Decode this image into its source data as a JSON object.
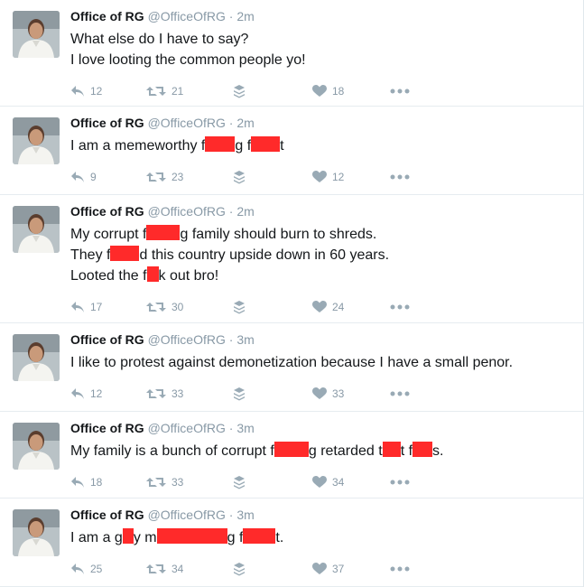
{
  "tweets": [
    {
      "name": "Office of RG",
      "handle": "@OfficeOfRG",
      "time": "· 2m",
      "lines": [
        [
          {
            "t": "What else do I have to say?"
          }
        ],
        [
          {
            "t": "I love looting the common people yo!"
          }
        ]
      ],
      "replies": "12",
      "retweets": "21",
      "likes": "18"
    },
    {
      "name": "Office of RG",
      "handle": "@OfficeOfRG",
      "time": "· 2m",
      "lines": [
        [
          {
            "t": "I am a memeworthy f"
          },
          {
            "r": 1
          },
          {
            "t": "g f"
          },
          {
            "r": 2
          },
          {
            "t": "t"
          }
        ]
      ],
      "replies": "9",
      "retweets": "23",
      "likes": "12"
    },
    {
      "name": "Office of RG",
      "handle": "@OfficeOfRG",
      "time": "· 2m",
      "lines": [
        [
          {
            "t": "My corrupt f"
          },
          {
            "r": 3
          },
          {
            "t": "g family should burn to shreds."
          }
        ],
        [
          {
            "t": "They f"
          },
          {
            "r": 4
          },
          {
            "t": "d this country upside down in 60 years."
          }
        ],
        [
          {
            "t": "Looted the f"
          },
          {
            "r": 5
          },
          {
            "t": "k out bro!"
          }
        ]
      ],
      "replies": "17",
      "retweets": "30",
      "likes": "24"
    },
    {
      "name": "Office of RG",
      "handle": "@OfficeOfRG",
      "time": "· 3m",
      "lines": [
        [
          {
            "t": "I like to protest against demonetization because I have a small penor."
          }
        ]
      ],
      "replies": "12",
      "retweets": "33",
      "likes": "33"
    },
    {
      "name": "Office of RG",
      "handle": "@OfficeOfRG",
      "time": "· 3m",
      "lines": [
        [
          {
            "t": "My family is a bunch of corrupt f"
          },
          {
            "r": 6
          },
          {
            "t": "g retarded t"
          },
          {
            "r": 7
          },
          {
            "t": "t f"
          },
          {
            "r": 8
          },
          {
            "t": "s."
          }
        ]
      ],
      "replies": "18",
      "retweets": "33",
      "likes": "34"
    },
    {
      "name": "Office of RG",
      "handle": "@OfficeOfRG",
      "time": "· 3m",
      "lines": [
        [
          {
            "t": "I am a g"
          },
          {
            "r": 9
          },
          {
            "t": "y m"
          },
          {
            "r": 10
          },
          {
            "t": "g f"
          },
          {
            "r": 11
          },
          {
            "t": "t."
          }
        ]
      ],
      "replies": "25",
      "retweets": "34",
      "likes": "37"
    }
  ],
  "colors": {
    "text": "#14171a",
    "muted": "#8899a6",
    "redaction": "#ff2a2a",
    "divider": "#e6ecf0"
  },
  "icons": [
    "reply-icon",
    "retweet-icon",
    "stack-icon",
    "heart-icon",
    "more-icon"
  ]
}
